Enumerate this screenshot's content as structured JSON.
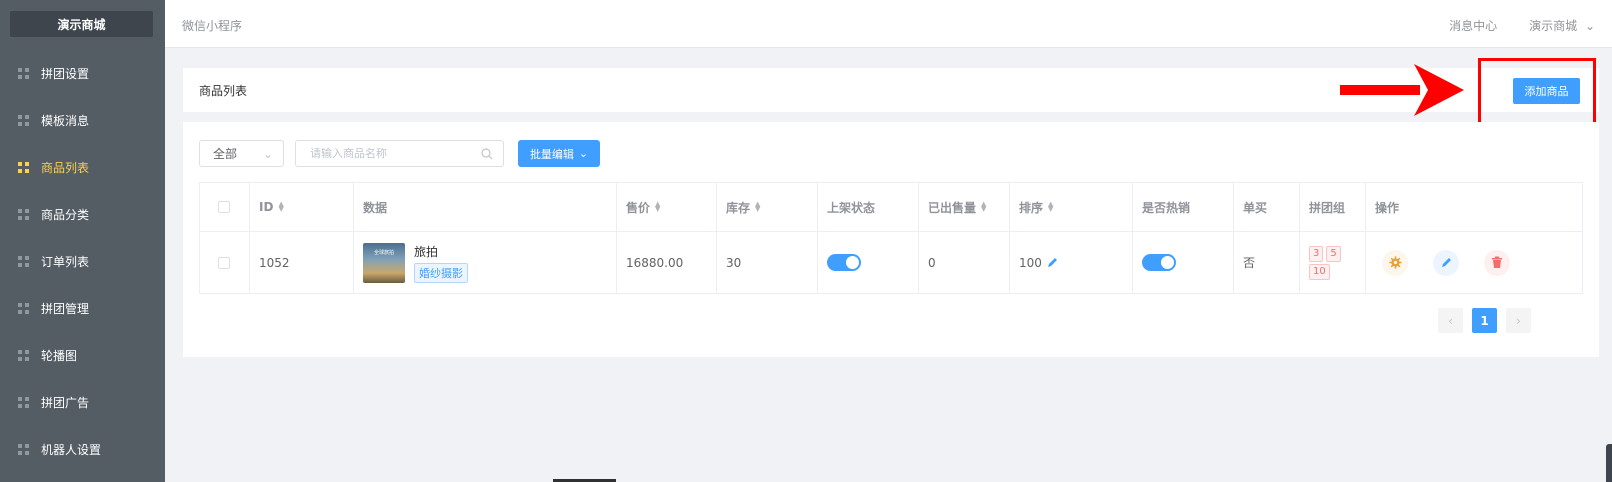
{
  "app": {
    "brand": "演示商城"
  },
  "sidebar": {
    "items": [
      {
        "label": "拼团设置",
        "active": false
      },
      {
        "label": "模板消息",
        "active": false
      },
      {
        "label": "商品列表",
        "active": true
      },
      {
        "label": "商品分类",
        "active": false
      },
      {
        "label": "订单列表",
        "active": false
      },
      {
        "label": "拼团管理",
        "active": false
      },
      {
        "label": "轮播图",
        "active": false
      },
      {
        "label": "拼团广告",
        "active": false
      },
      {
        "label": "机器人设置",
        "active": false
      }
    ]
  },
  "header": {
    "breadcrumb": "微信小程序",
    "messages": "消息中心",
    "store": "演示商城"
  },
  "page": {
    "title": "商品列表",
    "add_button": "添加商品"
  },
  "filters": {
    "status_value": "全部",
    "search_placeholder": "请输入商品名称",
    "batch_edit": "批量编辑"
  },
  "table": {
    "headers": {
      "id": "ID",
      "data": "数据",
      "price": "售价",
      "stock": "库存",
      "status": "上架状态",
      "sold": "已出售量",
      "sort": "排序",
      "hot": "是否热销",
      "single": "单买",
      "groups": "拼团组",
      "ops": "操作"
    },
    "rows": [
      {
        "id": "1052",
        "name": "旅拍",
        "tag": "婚纱摄影",
        "thumb_text": "全球旅拍",
        "price": "16880.00",
        "stock": "30",
        "on_shelf": true,
        "sold": "0",
        "sort": "100",
        "hot": true,
        "single": "否",
        "groups": [
          "3",
          "5",
          "10"
        ]
      }
    ]
  },
  "pagination": {
    "current": "1",
    "prev": "‹",
    "next": "›"
  },
  "colors": {
    "primary": "#409eff",
    "sidebar": "#545c64",
    "active": "#ffd04b",
    "annotation": "#ff0000"
  }
}
